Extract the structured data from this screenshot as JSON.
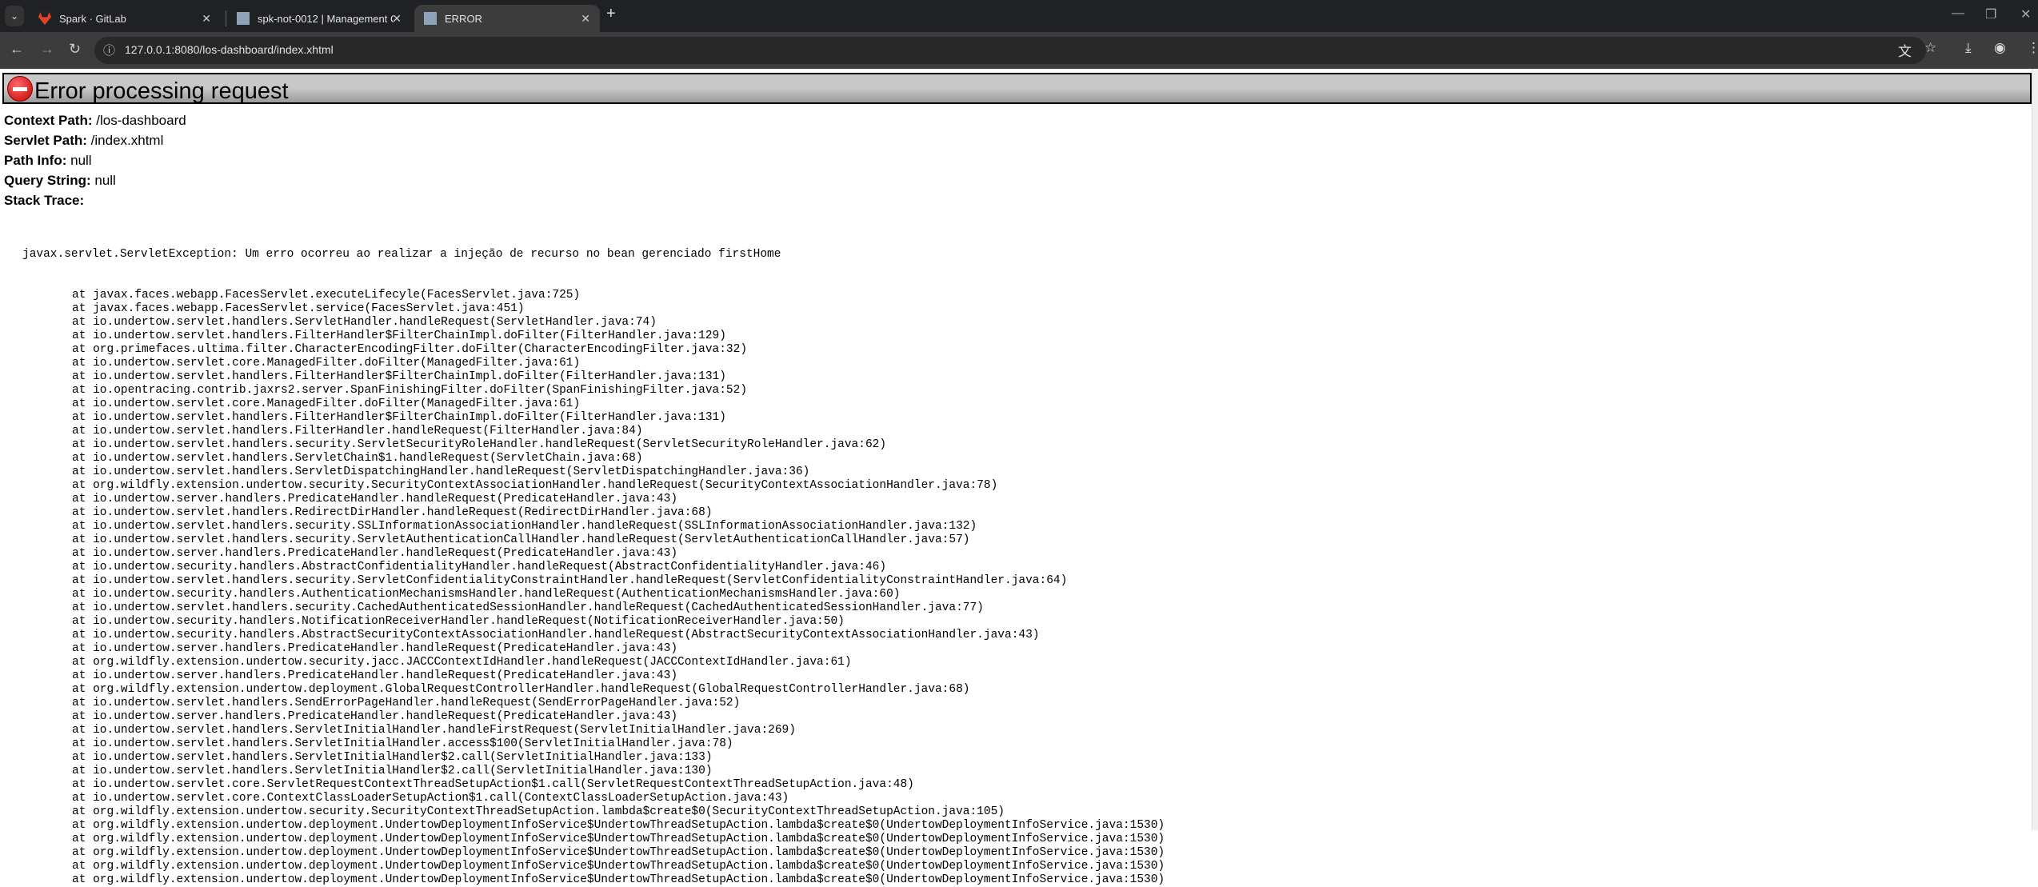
{
  "browser": {
    "tabs": [
      {
        "title": "Spark · GitLab",
        "icon": "gitlab-icon"
      },
      {
        "title": "spk-not-0012 | Management Co",
        "icon": "wildfly-icon"
      },
      {
        "title": "ERROR",
        "icon": "wildfly-icon",
        "active": true
      }
    ],
    "url": "127.0.0.1:8080/los-dashboard/index.xhtml"
  },
  "page": {
    "title": "Error processing request",
    "fields": [
      {
        "label": "Context Path:",
        "value": "/los-dashboard"
      },
      {
        "label": "Servlet Path:",
        "value": "/index.xhtml"
      },
      {
        "label": "Path Info:",
        "value": "null"
      },
      {
        "label": "Query String:",
        "value": "null"
      },
      {
        "label": "Stack Trace:",
        "value": ""
      }
    ],
    "exception": "javax.servlet.ServletException: Um erro ocorreu ao realizar a injeção de recurso no bean gerenciado firstHome",
    "frames": [
      "at javax.faces.webapp.FacesServlet.executeLifecyle(FacesServlet.java:725)",
      "at javax.faces.webapp.FacesServlet.service(FacesServlet.java:451)",
      "at io.undertow.servlet.handlers.ServletHandler.handleRequest(ServletHandler.java:74)",
      "at io.undertow.servlet.handlers.FilterHandler$FilterChainImpl.doFilter(FilterHandler.java:129)",
      "at org.primefaces.ultima.filter.CharacterEncodingFilter.doFilter(CharacterEncodingFilter.java:32)",
      "at io.undertow.servlet.core.ManagedFilter.doFilter(ManagedFilter.java:61)",
      "at io.undertow.servlet.handlers.FilterHandler$FilterChainImpl.doFilter(FilterHandler.java:131)",
      "at io.opentracing.contrib.jaxrs2.server.SpanFinishingFilter.doFilter(SpanFinishingFilter.java:52)",
      "at io.undertow.servlet.core.ManagedFilter.doFilter(ManagedFilter.java:61)",
      "at io.undertow.servlet.handlers.FilterHandler$FilterChainImpl.doFilter(FilterHandler.java:131)",
      "at io.undertow.servlet.handlers.FilterHandler.handleRequest(FilterHandler.java:84)",
      "at io.undertow.servlet.handlers.security.ServletSecurityRoleHandler.handleRequest(ServletSecurityRoleHandler.java:62)",
      "at io.undertow.servlet.handlers.ServletChain$1.handleRequest(ServletChain.java:68)",
      "at io.undertow.servlet.handlers.ServletDispatchingHandler.handleRequest(ServletDispatchingHandler.java:36)",
      "at org.wildfly.extension.undertow.security.SecurityContextAssociationHandler.handleRequest(SecurityContextAssociationHandler.java:78)",
      "at io.undertow.server.handlers.PredicateHandler.handleRequest(PredicateHandler.java:43)",
      "at io.undertow.servlet.handlers.RedirectDirHandler.handleRequest(RedirectDirHandler.java:68)",
      "at io.undertow.servlet.handlers.security.SSLInformationAssociationHandler.handleRequest(SSLInformationAssociationHandler.java:132)",
      "at io.undertow.servlet.handlers.security.ServletAuthenticationCallHandler.handleRequest(ServletAuthenticationCallHandler.java:57)",
      "at io.undertow.server.handlers.PredicateHandler.handleRequest(PredicateHandler.java:43)",
      "at io.undertow.security.handlers.AbstractConfidentialityHandler.handleRequest(AbstractConfidentialityHandler.java:46)",
      "at io.undertow.servlet.handlers.security.ServletConfidentialityConstraintHandler.handleRequest(ServletConfidentialityConstraintHandler.java:64)",
      "at io.undertow.security.handlers.AuthenticationMechanismsHandler.handleRequest(AuthenticationMechanismsHandler.java:60)",
      "at io.undertow.servlet.handlers.security.CachedAuthenticatedSessionHandler.handleRequest(CachedAuthenticatedSessionHandler.java:77)",
      "at io.undertow.security.handlers.NotificationReceiverHandler.handleRequest(NotificationReceiverHandler.java:50)",
      "at io.undertow.security.handlers.AbstractSecurityContextAssociationHandler.handleRequest(AbstractSecurityContextAssociationHandler.java:43)",
      "at io.undertow.server.handlers.PredicateHandler.handleRequest(PredicateHandler.java:43)",
      "at org.wildfly.extension.undertow.security.jacc.JACCContextIdHandler.handleRequest(JACCContextIdHandler.java:61)",
      "at io.undertow.server.handlers.PredicateHandler.handleRequest(PredicateHandler.java:43)",
      "at org.wildfly.extension.undertow.deployment.GlobalRequestControllerHandler.handleRequest(GlobalRequestControllerHandler.java:68)",
      "at io.undertow.servlet.handlers.SendErrorPageHandler.handleRequest(SendErrorPageHandler.java:52)",
      "at io.undertow.server.handlers.PredicateHandler.handleRequest(PredicateHandler.java:43)",
      "at io.undertow.servlet.handlers.ServletInitialHandler.handleFirstRequest(ServletInitialHandler.java:269)",
      "at io.undertow.servlet.handlers.ServletInitialHandler.access$100(ServletInitialHandler.java:78)",
      "at io.undertow.servlet.handlers.ServletInitialHandler$2.call(ServletInitialHandler.java:133)",
      "at io.undertow.servlet.handlers.ServletInitialHandler$2.call(ServletInitialHandler.java:130)",
      "at io.undertow.servlet.core.ServletRequestContextThreadSetupAction$1.call(ServletRequestContextThreadSetupAction.java:48)",
      "at io.undertow.servlet.core.ContextClassLoaderSetupAction$1.call(ContextClassLoaderSetupAction.java:43)",
      "at org.wildfly.extension.undertow.security.SecurityContextThreadSetupAction.lambda$create$0(SecurityContextThreadSetupAction.java:105)",
      "at org.wildfly.extension.undertow.deployment.UndertowDeploymentInfoService$UndertowThreadSetupAction.lambda$create$0(UndertowDeploymentInfoService.java:1530)",
      "at org.wildfly.extension.undertow.deployment.UndertowDeploymentInfoService$UndertowThreadSetupAction.lambda$create$0(UndertowDeploymentInfoService.java:1530)",
      "at org.wildfly.extension.undertow.deployment.UndertowDeploymentInfoService$UndertowThreadSetupAction.lambda$create$0(UndertowDeploymentInfoService.java:1530)",
      "at org.wildfly.extension.undertow.deployment.UndertowDeploymentInfoService$UndertowThreadSetupAction.lambda$create$0(UndertowDeploymentInfoService.java:1530)",
      "at org.wildfly.extension.undertow.deployment.UndertowDeploymentInfoService$UndertowThreadSetupAction.lambda$create$0(UndertowDeploymentInfoService.java:1530)"
    ]
  }
}
